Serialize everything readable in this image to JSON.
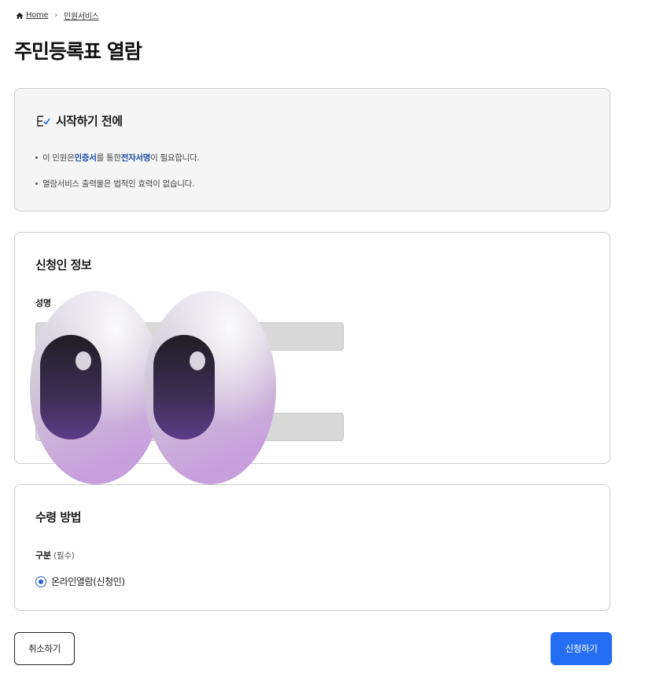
{
  "breadcrumb": {
    "home_label": "Home",
    "separator": "›",
    "current_label": "민원서비스"
  },
  "page": {
    "title": "주민등록표 열람"
  },
  "notice": {
    "title": "시작하기 전에",
    "item1_pre": "이 민원은 ",
    "item1_strong1": "인증서",
    "item1_mid": "를 통한 ",
    "item1_strong2": "전자서명",
    "item1_post": "이 필요합니다.",
    "item2": "열람서비스 출력물은 법적인 효력이 없습니다."
  },
  "applicant": {
    "title": "신청인 정보",
    "name_label": "성명"
  },
  "receipt": {
    "title": "수령 방법",
    "type_label": "구분",
    "type_required": "(필수)",
    "option_label": "온라인열람(신청인)",
    "option_selected": true
  },
  "actions": {
    "cancel_label": "취소하기",
    "submit_label": "신청하기"
  },
  "colors": {
    "primary": "#256ef4",
    "highlight_text": "#1d4ea8",
    "notice_bg": "#f5f5f5",
    "input_bg": "#d9d9d9"
  },
  "icons": {
    "home": "home-icon",
    "notice": "checklist-icon",
    "radio": "radio-selected-icon",
    "overlay": "mascot-eyes"
  }
}
